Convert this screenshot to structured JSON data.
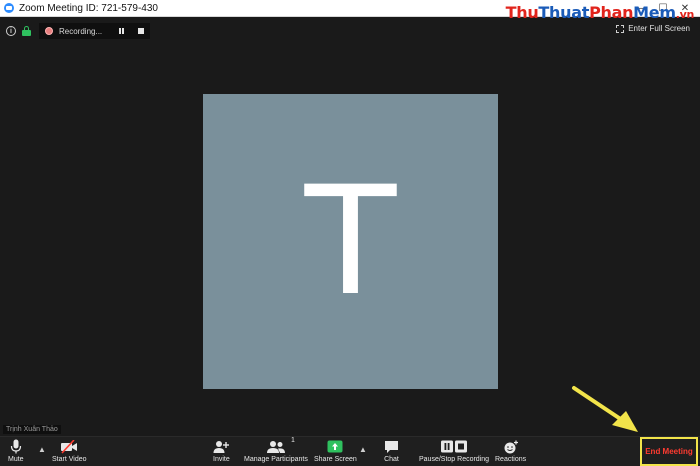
{
  "window": {
    "title": "Zoom Meeting ID: 721-579-430",
    "controls": [
      "—",
      "☐",
      "✕"
    ]
  },
  "watermark": {
    "part1": "Thu",
    "part2": "Thuat",
    "part3": "Phan",
    "part4": "Mem",
    "part5": ".vn"
  },
  "status": {
    "recording_text": "Recording...",
    "fullscreen_label": "Enter Full Screen"
  },
  "participant": {
    "initial": "T",
    "name": "Trịnh Xuân Thảo"
  },
  "toolbar": {
    "mute": "Mute",
    "start_video": "Start Video",
    "invite": "Invite",
    "manage_participants": "Manage Participants",
    "participant_count": "1",
    "share_screen": "Share Screen",
    "chat": "Chat",
    "pause_stop_recording": "Pause/Stop Recording",
    "reactions": "Reactions",
    "end_meeting": "End Meeting"
  },
  "colors": {
    "background": "#1a1a1a",
    "tile": "#7a909b",
    "end_meeting": "#ff3b30",
    "highlight": "#f2e44a",
    "share_screen": "#2fc15f"
  }
}
